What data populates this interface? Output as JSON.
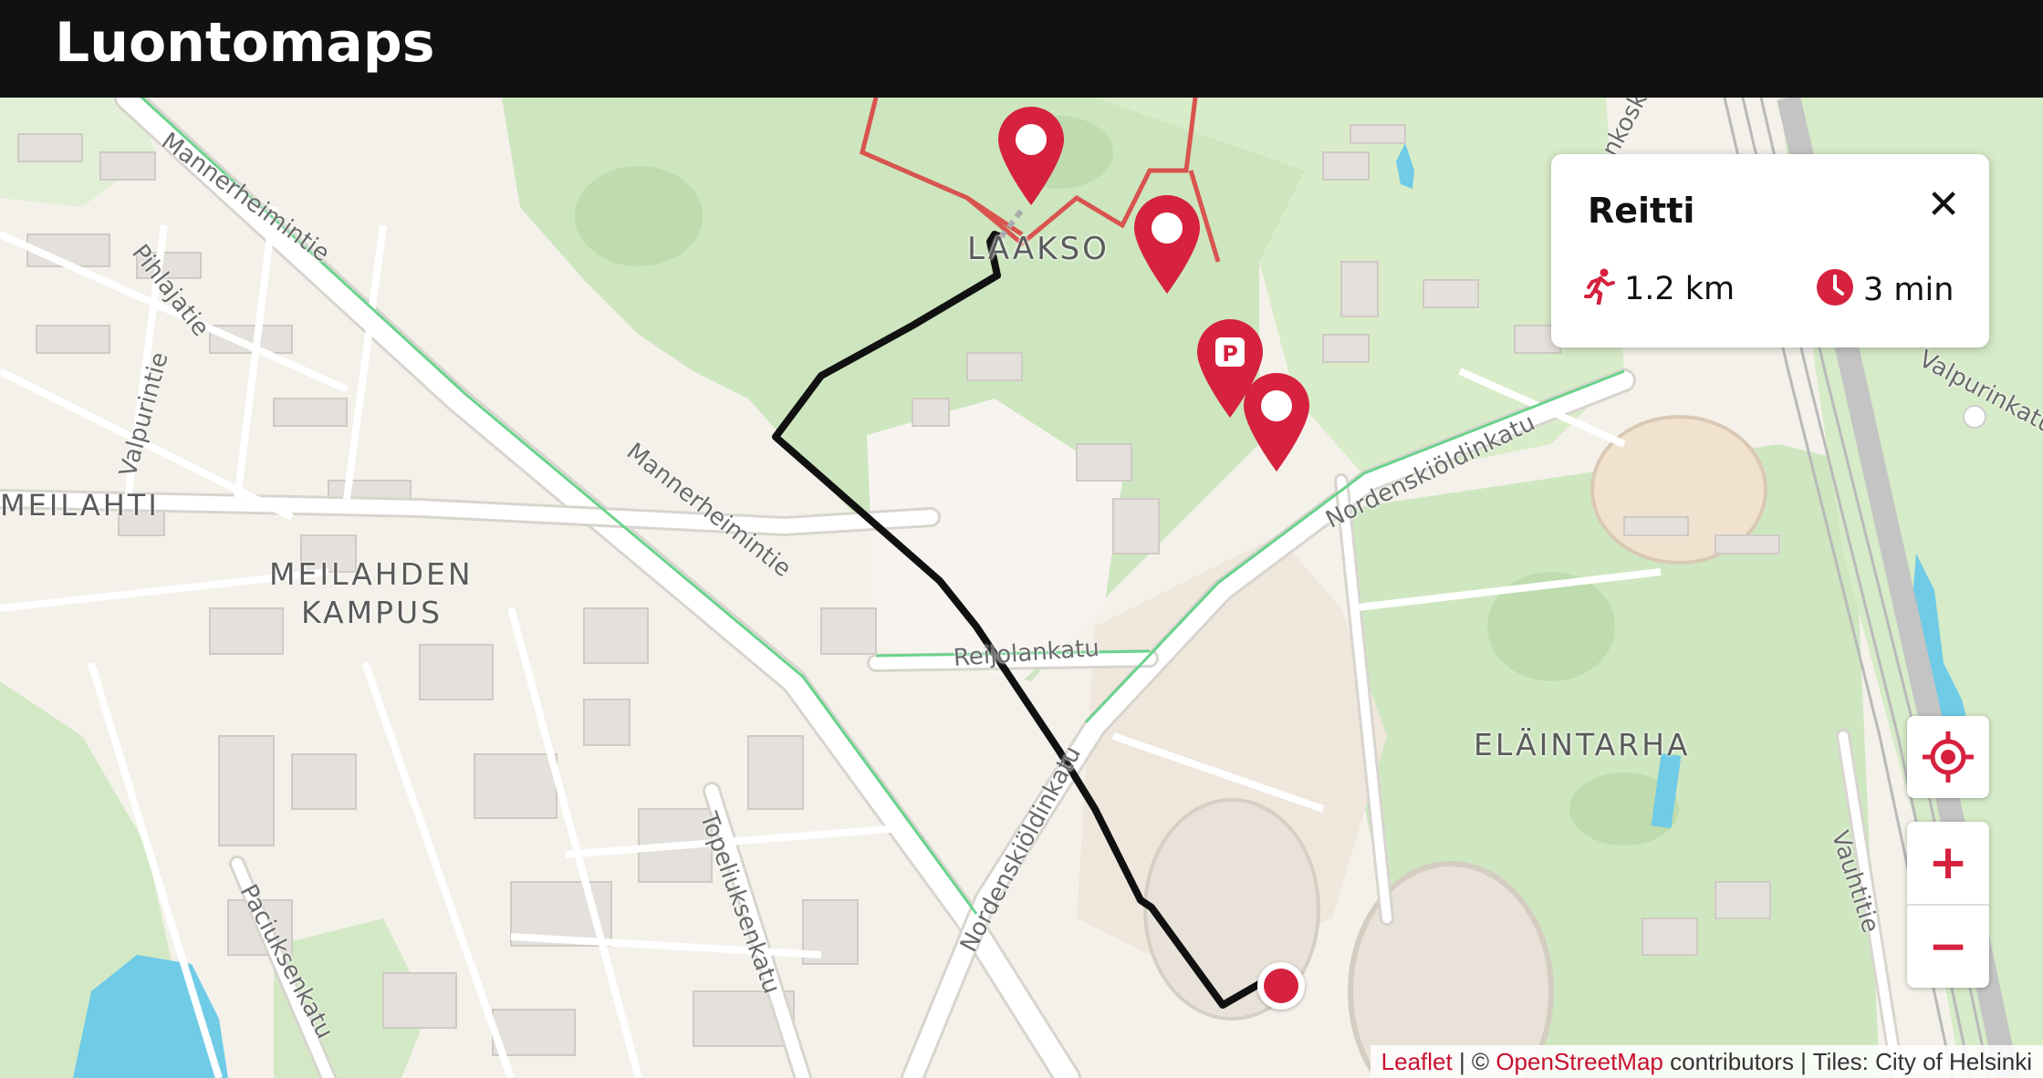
{
  "header": {
    "title": "Luontomaps"
  },
  "map": {
    "district_labels": [
      "LAAKSO",
      "MEILAHTI",
      "MEILAHDEN",
      "KAMPUS",
      "ELÄINTARHA"
    ],
    "street_labels": [
      "Mannerheimintie",
      "Pihlajatie",
      "Valpurintie",
      "Mannerheimintie",
      "Reijolankatu",
      "Nordenskiöldinkatu",
      "Nordenskiöldinkatu",
      "Topeliuksenkatu",
      "Paciuksenkatu",
      "Vauhtitie",
      "Valpurinkatu",
      "Linnankoskenkatu"
    ],
    "markers": [
      {
        "name": "place-marker-1",
        "icon": "circle"
      },
      {
        "name": "place-marker-2",
        "icon": "circle"
      },
      {
        "name": "parking-marker",
        "icon": "P"
      },
      {
        "name": "place-marker-3",
        "icon": "circle"
      }
    ],
    "colors": {
      "route": "#111111",
      "trail": "#d9534f",
      "accent": "#d6213f"
    }
  },
  "route_card": {
    "title": "Reitti",
    "close_icon": "close-icon",
    "distance": "1.2 km",
    "duration": "3 min",
    "distance_icon": "walking-icon",
    "duration_icon": "clock-icon"
  },
  "controls": {
    "locate_icon": "crosshair-icon",
    "zoom_in": "+",
    "zoom_out": "−"
  },
  "attribution": {
    "leaflet": "Leaflet",
    "sep1": " | © ",
    "osm": "OpenStreetMap",
    "rest": " contributors | Tiles: City of Helsinki"
  }
}
